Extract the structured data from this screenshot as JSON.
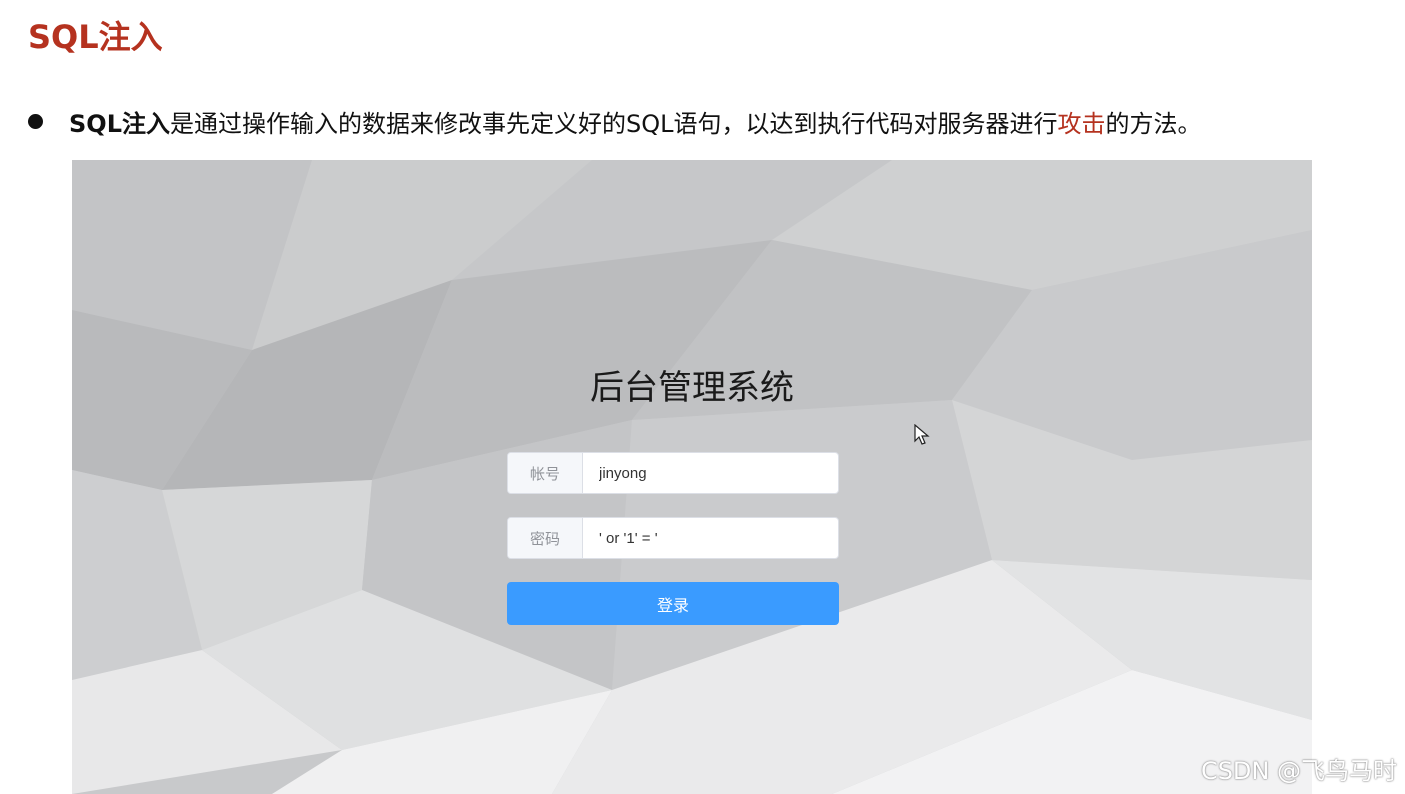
{
  "slide": {
    "title": "SQL注入",
    "bullet": {
      "term": "SQL注入",
      "text_before": "是通过操作输入的数据来修改事先定义好的SQL语句，以达到执行代码对服务器进行",
      "highlight": "攻击",
      "text_after": "的方法。"
    }
  },
  "login_page": {
    "title": "后台管理系统",
    "username": {
      "label": "帐号",
      "value": "jinyong"
    },
    "password": {
      "label": "密码",
      "value": "' or '1' = '"
    },
    "submit_label": "登录"
  },
  "watermark": "CSDN @飞鸟马时",
  "colors": {
    "title_red": "#b5321f",
    "button_blue": "#3a9bff",
    "background_gray": "#c8c9cb"
  },
  "icons": {
    "bullet": "bullet-dot",
    "cursor": "mouse-pointer-icon"
  }
}
